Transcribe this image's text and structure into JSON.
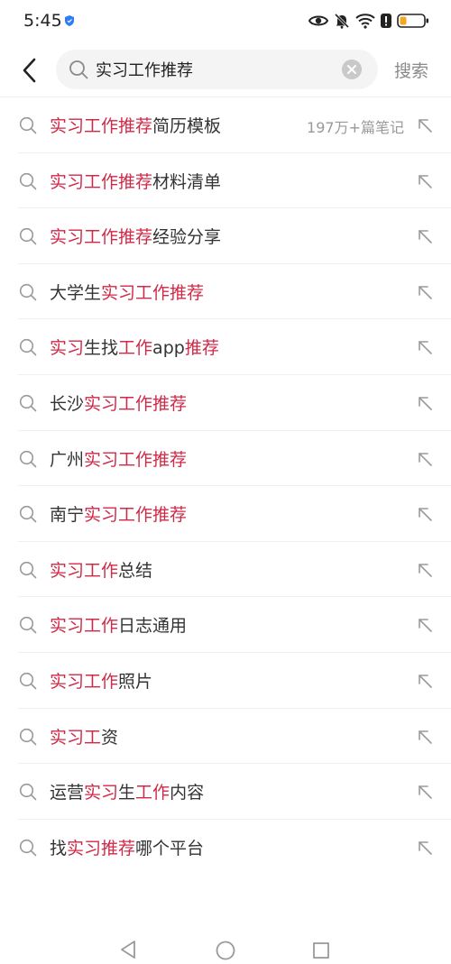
{
  "status_bar": {
    "time": "5:45",
    "icons": [
      "shield-icon",
      "eye-icon",
      "mute-bell-icon",
      "wifi-icon",
      "alert-icon",
      "battery-icon"
    ],
    "battery_color": "#f5a623"
  },
  "search": {
    "query": "实习工作推荐",
    "button_label": "搜索"
  },
  "colors": {
    "highlight": "#d02947",
    "text": "#333333",
    "muted": "#999999"
  },
  "suggestions": [
    {
      "parts": [
        {
          "t": "实习工作推荐",
          "hl": true
        },
        {
          "t": "简历模板",
          "hl": false
        }
      ],
      "note": "197万+篇笔记"
    },
    {
      "parts": [
        {
          "t": "实习工作推荐",
          "hl": true
        },
        {
          "t": "材料清单",
          "hl": false
        }
      ]
    },
    {
      "parts": [
        {
          "t": "实习工作推荐",
          "hl": true
        },
        {
          "t": "经验分享",
          "hl": false
        }
      ]
    },
    {
      "parts": [
        {
          "t": "大学生",
          "hl": false
        },
        {
          "t": "实习工作推荐",
          "hl": true
        }
      ]
    },
    {
      "parts": [
        {
          "t": "实习",
          "hl": true
        },
        {
          "t": "生找",
          "hl": false
        },
        {
          "t": "工作",
          "hl": true
        },
        {
          "t": "app",
          "hl": false
        },
        {
          "t": "推荐",
          "hl": true
        }
      ]
    },
    {
      "parts": [
        {
          "t": "长沙",
          "hl": false
        },
        {
          "t": "实习工作推荐",
          "hl": true
        }
      ]
    },
    {
      "parts": [
        {
          "t": "广州",
          "hl": false
        },
        {
          "t": "实习工作推荐",
          "hl": true
        }
      ]
    },
    {
      "parts": [
        {
          "t": "南宁",
          "hl": false
        },
        {
          "t": "实习工作推荐",
          "hl": true
        }
      ]
    },
    {
      "parts": [
        {
          "t": "实习工作",
          "hl": true
        },
        {
          "t": "总结",
          "hl": false
        }
      ]
    },
    {
      "parts": [
        {
          "t": "实习工作",
          "hl": true
        },
        {
          "t": "日志通用",
          "hl": false
        }
      ]
    },
    {
      "parts": [
        {
          "t": "实习工作",
          "hl": true
        },
        {
          "t": "照片",
          "hl": false
        }
      ]
    },
    {
      "parts": [
        {
          "t": "实习工",
          "hl": true
        },
        {
          "t": "资",
          "hl": false
        }
      ]
    },
    {
      "parts": [
        {
          "t": "运营",
          "hl": false
        },
        {
          "t": "实习",
          "hl": true
        },
        {
          "t": "生",
          "hl": false
        },
        {
          "t": "工作",
          "hl": true
        },
        {
          "t": "内容",
          "hl": false
        }
      ]
    },
    {
      "parts": [
        {
          "t": "找",
          "hl": false
        },
        {
          "t": "实习推荐",
          "hl": true
        },
        {
          "t": "哪个平台",
          "hl": false
        }
      ]
    }
  ],
  "nav_bar": {
    "buttons": [
      "back-triangle-icon",
      "home-circle-icon",
      "recent-square-icon"
    ]
  }
}
